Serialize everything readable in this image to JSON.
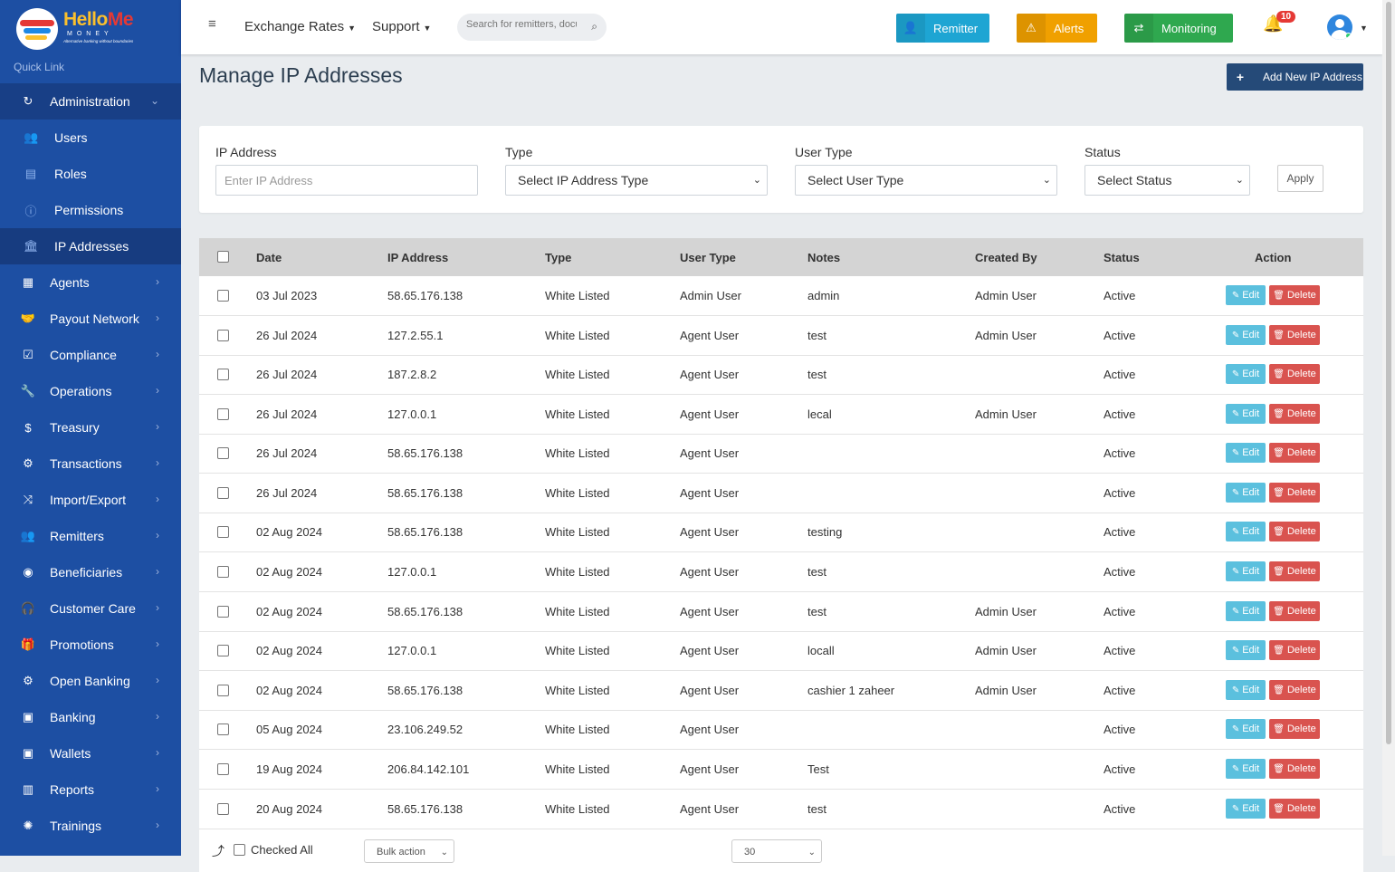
{
  "brand": {
    "name_part1": "Hello",
    "name_part2": "Me",
    "sub": "MONEY",
    "tagline": "Alternative banking without boundaries"
  },
  "sidebar": {
    "quick_link": "Quick Link",
    "administration": "Administration",
    "sub_items": [
      {
        "label": "Users",
        "icon": "users-icon"
      },
      {
        "label": "Roles",
        "icon": "id-card-icon"
      },
      {
        "label": "Permissions",
        "icon": "info-icon"
      },
      {
        "label": "IP Addresses",
        "icon": "bank-icon"
      }
    ],
    "items": [
      {
        "label": "Agents",
        "icon": "building-icon"
      },
      {
        "label": "Payout Network",
        "icon": "handshake-icon"
      },
      {
        "label": "Compliance",
        "icon": "check-square-icon"
      },
      {
        "label": "Operations",
        "icon": "wrench-icon"
      },
      {
        "label": "Treasury",
        "icon": "dollar-icon"
      },
      {
        "label": "Transactions",
        "icon": "cogs-icon"
      },
      {
        "label": "Import/Export",
        "icon": "random-icon"
      },
      {
        "label": "Remitters",
        "icon": "users-icon"
      },
      {
        "label": "Beneficiaries",
        "icon": "user-circle-icon"
      },
      {
        "label": "Customer Care",
        "icon": "headphones-icon"
      },
      {
        "label": "Promotions",
        "icon": "gift-icon"
      },
      {
        "label": "Open Banking",
        "icon": "gear-icon"
      },
      {
        "label": "Banking",
        "icon": "money-icon"
      },
      {
        "label": "Wallets",
        "icon": "money-icon"
      },
      {
        "label": "Reports",
        "icon": "bar-chart-icon"
      },
      {
        "label": "Trainings",
        "icon": "certificate-icon"
      }
    ]
  },
  "topbar": {
    "exchange_rates": "Exchange Rates",
    "support": "Support",
    "search_placeholder": "Search for remitters, documents",
    "remitter_label": "Remitter",
    "alerts_label": "Alerts",
    "monitoring_label": "Monitoring",
    "notifications_count": "10",
    "colors": {
      "remitter": "#1ea5d3",
      "alerts": "#f0a000",
      "monitoring": "#2fa84f"
    }
  },
  "page": {
    "title": "Manage IP Addresses",
    "add_button": "Add New IP Address"
  },
  "filters": {
    "ip_label": "IP Address",
    "ip_placeholder": "Enter IP Address",
    "type_label": "Type",
    "type_value": "Select IP Address Type",
    "user_type_label": "User Type",
    "user_type_value": "Select User Type",
    "status_label": "Status",
    "status_value": "Select Status",
    "apply": "Apply"
  },
  "table": {
    "headers": {
      "date": "Date",
      "ip": "IP Address",
      "type": "Type",
      "user_type": "User Type",
      "notes": "Notes",
      "created_by": "Created By",
      "status": "Status",
      "action": "Action"
    },
    "edit_label": "Edit",
    "delete_label": "Delete",
    "rows": [
      {
        "date": "03 Jul 2023",
        "ip": "58.65.176.138",
        "type": "White Listed",
        "user_type": "Admin User",
        "notes": "admin",
        "created_by": "Admin User",
        "status": "Active"
      },
      {
        "date": "26 Jul 2024",
        "ip": "127.2.55.1",
        "type": "White Listed",
        "user_type": "Agent User",
        "notes": "test",
        "created_by": "Admin User",
        "status": "Active"
      },
      {
        "date": "26 Jul 2024",
        "ip": "187.2.8.2",
        "type": "White Listed",
        "user_type": "Agent User",
        "notes": "test",
        "created_by": "",
        "status": "Active"
      },
      {
        "date": "26 Jul 2024",
        "ip": "127.0.0.1",
        "type": "White Listed",
        "user_type": "Agent User",
        "notes": "lecal",
        "created_by": "Admin User",
        "status": "Active"
      },
      {
        "date": "26 Jul 2024",
        "ip": "58.65.176.138",
        "type": "White Listed",
        "user_type": "Agent User",
        "notes": "",
        "created_by": "",
        "status": "Active"
      },
      {
        "date": "26 Jul 2024",
        "ip": "58.65.176.138",
        "type": "White Listed",
        "user_type": "Agent User",
        "notes": "",
        "created_by": "",
        "status": "Active"
      },
      {
        "date": "02 Aug 2024",
        "ip": "58.65.176.138",
        "type": "White Listed",
        "user_type": "Agent User",
        "notes": "testing",
        "created_by": "",
        "status": "Active"
      },
      {
        "date": "02 Aug 2024",
        "ip": "127.0.0.1",
        "type": "White Listed",
        "user_type": "Agent User",
        "notes": "test",
        "created_by": "",
        "status": "Active"
      },
      {
        "date": "02 Aug 2024",
        "ip": "58.65.176.138",
        "type": "White Listed",
        "user_type": "Agent User",
        "notes": "test",
        "created_by": "Admin User",
        "status": "Active"
      },
      {
        "date": "02 Aug 2024",
        "ip": "127.0.0.1",
        "type": "White Listed",
        "user_type": "Agent User",
        "notes": "locall",
        "created_by": "Admin User",
        "status": "Active"
      },
      {
        "date": "02 Aug 2024",
        "ip": "58.65.176.138",
        "type": "White Listed",
        "user_type": "Agent User",
        "notes": "cashier 1 zaheer",
        "created_by": "Admin User",
        "status": "Active"
      },
      {
        "date": "05 Aug 2024",
        "ip": "23.106.249.52",
        "type": "White Listed",
        "user_type": "Agent User",
        "notes": "",
        "created_by": "",
        "status": "Active"
      },
      {
        "date": "19 Aug 2024",
        "ip": "206.84.142.101",
        "type": "White Listed",
        "user_type": "Agent User",
        "notes": "Test",
        "created_by": "",
        "status": "Active"
      },
      {
        "date": "20 Aug 2024",
        "ip": "58.65.176.138",
        "type": "White Listed",
        "user_type": "Agent User",
        "notes": "test",
        "created_by": "",
        "status": "Active"
      }
    ]
  },
  "footer": {
    "checked_all": "Checked All",
    "bulk_action": "Bulk action",
    "per_page": "30"
  }
}
